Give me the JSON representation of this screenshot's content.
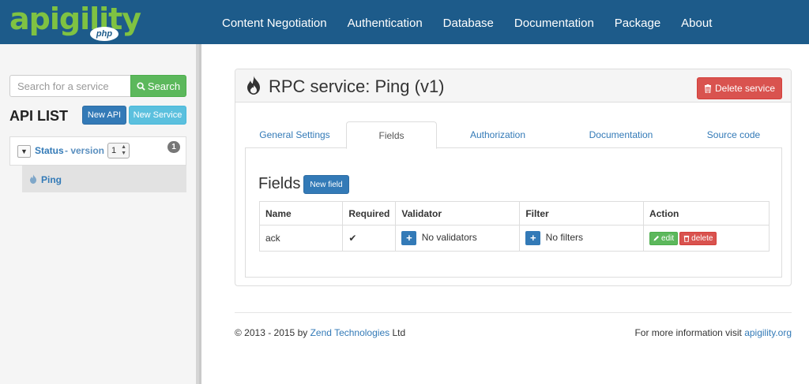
{
  "brand": {
    "logo_text": "apigility",
    "logo_badge": "php",
    "accent": "#7fc242",
    "nav_bg": "#1d5b8a"
  },
  "nav": {
    "items": [
      {
        "label": "Content Negotiation"
      },
      {
        "label": "Authentication"
      },
      {
        "label": "Database"
      },
      {
        "label": "Documentation"
      },
      {
        "label": "Package"
      },
      {
        "label": "About"
      }
    ]
  },
  "sidebar": {
    "search": {
      "placeholder": "Search for a service",
      "button_label": "Search",
      "icon": "search-icon"
    },
    "title": "API LIST",
    "new_api_label": "New API",
    "new_service_label": "New Service",
    "api": {
      "name": "Status",
      "version_label": "- version",
      "version": "1",
      "service_count": "1",
      "toggle_icon": "chevron-down-icon"
    },
    "services": [
      {
        "name": "Ping",
        "icon": "flame-icon"
      }
    ]
  },
  "panel": {
    "title": "RPC service: Ping (v1)",
    "title_icon": "flame-icon",
    "delete_label": "Delete service",
    "tabs": [
      {
        "label": "General Settings"
      },
      {
        "label": "Fields",
        "active": true
      },
      {
        "label": "Authorization"
      },
      {
        "label": "Documentation"
      },
      {
        "label": "Source code"
      }
    ],
    "fields": {
      "title": "Fields",
      "new_label": "New field",
      "columns": [
        "Name",
        "Required",
        "Validator",
        "Filter",
        "Action"
      ],
      "rows": [
        {
          "name": "ack",
          "required": "✔",
          "validator": "No validators",
          "filter": "No filters",
          "edit_label": "edit",
          "delete_label": "delete"
        }
      ]
    }
  },
  "footer": {
    "copyright_prefix": "© 2013 - 2015 by",
    "company": "Zend Technologies",
    "copyright_suffix": "Ltd",
    "more_info": "For more information visit",
    "site": "apigility.org"
  }
}
